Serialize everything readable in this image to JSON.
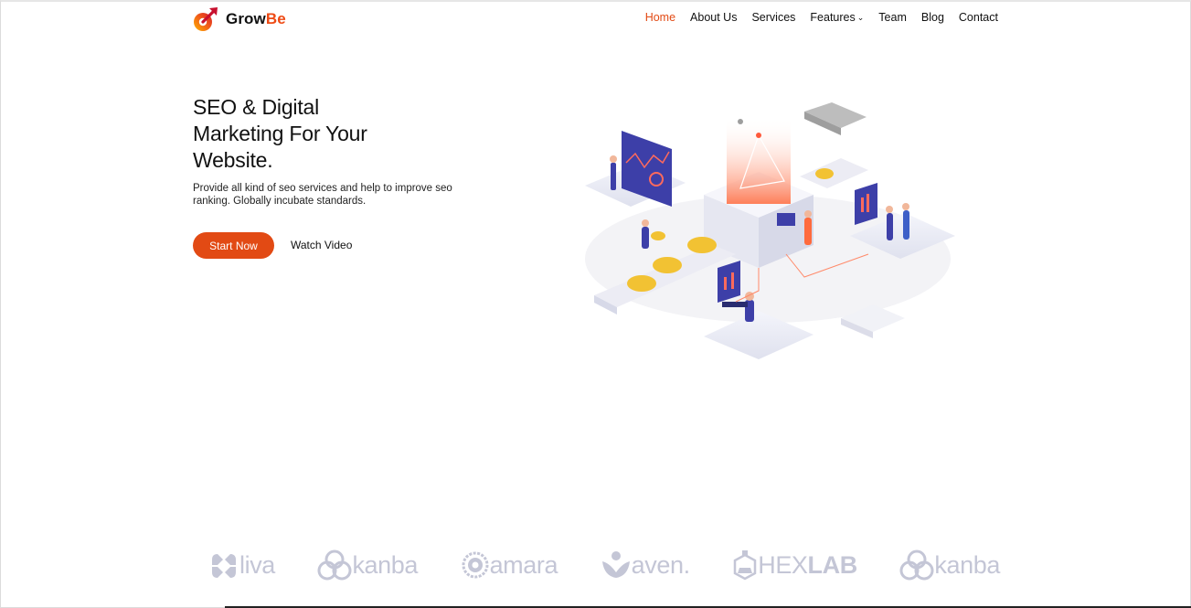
{
  "brand": {
    "name_part1": "Grow",
    "name_part2": "Be",
    "accent_color": "#e24a14"
  },
  "nav": {
    "items": [
      {
        "label": "Home",
        "active": true
      },
      {
        "label": "About Us"
      },
      {
        "label": "Services"
      },
      {
        "label": "Features",
        "has_dropdown": true
      },
      {
        "label": "Team"
      },
      {
        "label": "Blog"
      },
      {
        "label": "Contact"
      }
    ]
  },
  "hero": {
    "title_line1": "SEO & Digital",
    "title_line2": "Marketing For Your",
    "title_line3": "Website.",
    "description": "Provide all kind of seo services and help to improve seo ranking. Globally incubate standards.",
    "start_button": "Start Now",
    "watch_button": "Watch Video"
  },
  "partners": [
    {
      "name": "liva",
      "icon": "liva-icon"
    },
    {
      "name": "kanba",
      "icon": "kanba-icon"
    },
    {
      "name": "amara",
      "icon": "amara-icon"
    },
    {
      "name": "aven.",
      "icon": "aven-icon"
    },
    {
      "name_part1": "HEX",
      "name_part2": "LAB",
      "icon": "hexlab-icon"
    },
    {
      "name": "kanba",
      "icon": "kanba-icon"
    }
  ]
}
